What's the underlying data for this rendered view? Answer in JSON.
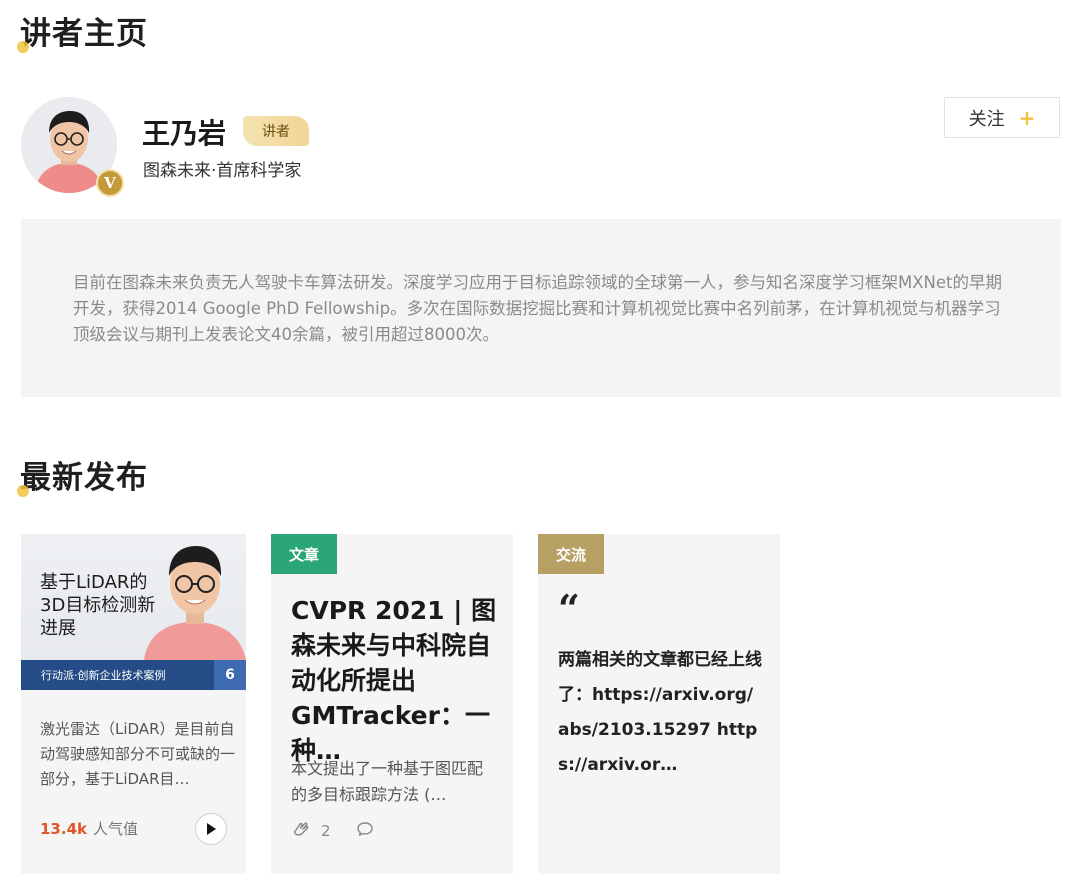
{
  "header": {
    "title": "讲者主页"
  },
  "profile": {
    "name": "王乃岩",
    "role_badge": "讲者",
    "verified_mark": "V",
    "affiliation": "图森未来·首席科学家",
    "follow_label": "关注",
    "follow_icon": "plus-icon",
    "bio": "目前在图森未来负责无人驾驶卡车算法研发。深度学习应用于目标追踪领域的全球第一人，参与知名深度学习框架MXNet的早期开发，获得2014 Google PhD Fellowship。多次在国际数据挖掘比赛和计算机视觉比赛中名列前茅，在计算机视觉与机器学习顶级会议与期刊上发表论文40余篇，被引用超过8000次。"
  },
  "latest": {
    "title": "最新发布",
    "cards": [
      {
        "type": "video",
        "thumb_title": "基于LiDAR的3D目标检测新进展",
        "thumb_bar_text": "行动派·创新企业技术案例",
        "thumb_bar_num": "6",
        "desc": "激光雷达（LiDAR）是目前自动驾驶感知部分不可或缺的一部分，基于LiDAR目…",
        "popularity": "13.4k",
        "popularity_label": "人气值"
      },
      {
        "type": "article",
        "tag": "文章",
        "title": "CVPR 2021 | 图森未来与中科院自动化所提出GMTracker：一种…",
        "desc": "本文提出了一种基于图匹配的多目标跟踪方法 (…",
        "likes": "2"
      },
      {
        "type": "exchange",
        "tag": "交流",
        "quote_mark": "“",
        "text": "两篇相关的文章都已经上线了：https://arxiv.org/abs/2103.15297 https://arxiv.or…"
      }
    ]
  },
  "colors": {
    "accent": "#f0c33c",
    "tag_article": "#2aa676",
    "tag_exchange": "#b6a064",
    "popularity": "#e0552b",
    "thumb_bar": "#254c86"
  }
}
